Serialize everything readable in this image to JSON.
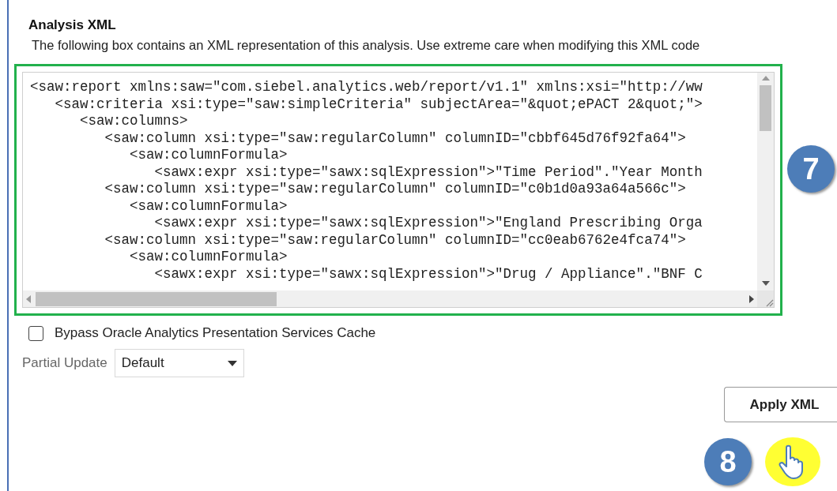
{
  "section": {
    "title": "Analysis XML",
    "description": "The following box contains an XML representation of this analysis. Use extreme care when modifying this XML code"
  },
  "xml_editor": {
    "lines": [
      "<saw:report xmlns:saw=\"com.siebel.analytics.web/report/v1.1\" xmlns:xsi=\"http://ww",
      "   <saw:criteria xsi:type=\"saw:simpleCriteria\" subjectArea=\"&quot;ePACT 2&quot;\">",
      "      <saw:columns>",
      "         <saw:column xsi:type=\"saw:regularColumn\" columnID=\"cbbf645d76f92fa64\">",
      "            <saw:columnFormula>",
      "               <sawx:expr xsi:type=\"sawx:sqlExpression\">\"Time Period\".\"Year Month",
      "         <saw:column xsi:type=\"saw:regularColumn\" columnID=\"c0b1d0a93a64a566c\">",
      "            <saw:columnFormula>",
      "               <sawx:expr xsi:type=\"sawx:sqlExpression\">\"England Prescribing Orga",
      "         <saw:column xsi:type=\"saw:regularColumn\" columnID=\"cc0eab6762e4fca74\">",
      "            <saw:columnFormula>",
      "               <sawx:expr xsi:type=\"sawx:sqlExpression\">\"Drug / Appliance\".\"BNF C"
    ]
  },
  "bypass_cache": {
    "label": "Bypass Oracle Analytics Presentation Services Cache",
    "checked": false
  },
  "partial_update": {
    "label": "Partial Update",
    "value": "Default"
  },
  "apply_button": {
    "label": "Apply XML"
  },
  "callouts": [
    {
      "number": "7"
    },
    {
      "number": "8"
    }
  ]
}
